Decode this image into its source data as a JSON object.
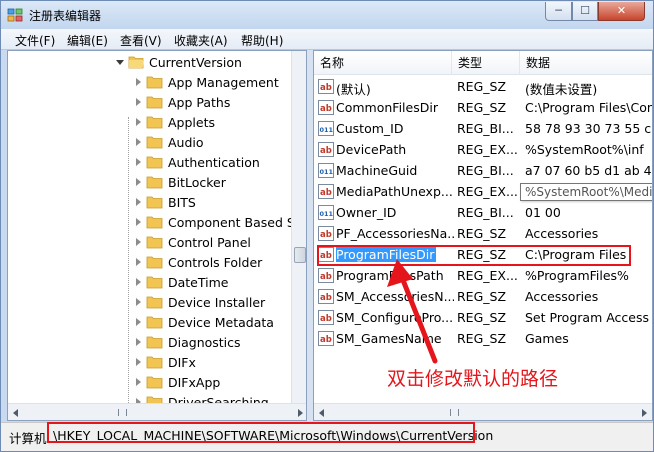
{
  "window": {
    "title": "注册表编辑器",
    "minimize": "─",
    "maximize": "☐",
    "close": "✕"
  },
  "menu": [
    "文件(F)",
    "编辑(E)",
    "查看(V)",
    "收藏夹(A)",
    "帮助(H)"
  ],
  "tree": {
    "parent": "CurrentVersion",
    "children": [
      "App Management",
      "App Paths",
      "Applets",
      "Audio",
      "Authentication",
      "BitLocker",
      "BITS",
      "Component Based Se",
      "Control Panel",
      "Controls Folder",
      "DateTime",
      "Device Installer",
      "Device Metadata",
      "Diagnostics",
      "DIFx",
      "DIFxApp",
      "DriverSearching"
    ]
  },
  "list": {
    "headers": [
      "名称",
      "类型",
      "数据"
    ],
    "rows": [
      {
        "icon": "string-value-icon",
        "name": "(默认)",
        "type": "REG_SZ",
        "data": "(数值未设置)"
      },
      {
        "icon": "string-value-icon",
        "name": "CommonFilesDir",
        "type": "REG_SZ",
        "data": "C:\\Program Files\\Con"
      },
      {
        "icon": "binary-value-icon",
        "name": "Custom_ID",
        "type": "REG_BI...",
        "data": "58 78 93 30 73 55 c8"
      },
      {
        "icon": "string-value-icon",
        "name": "DevicePath",
        "type": "REG_EX...",
        "data": "%SystemRoot%\\inf"
      },
      {
        "icon": "binary-value-icon",
        "name": "MachineGuid",
        "type": "REG_BI...",
        "data": "a7 07 60 b5 d1 ab 4a"
      },
      {
        "icon": "string-value-icon",
        "name": "MediaPathUnexp...",
        "type": "REG_EX...",
        "data": ""
      },
      {
        "icon": "binary-value-icon",
        "name": "Owner_ID",
        "type": "REG_BI...",
        "data": "01 00"
      },
      {
        "icon": "string-value-icon",
        "name": "PF_AccessoriesNa...",
        "type": "REG_SZ",
        "data": "Accessories"
      },
      {
        "icon": "string-value-icon",
        "name": "ProgramFilesDir",
        "type": "REG_SZ",
        "data": "C:\\Program Files"
      },
      {
        "icon": "string-value-icon",
        "name": "ProgramFilesPath",
        "type": "REG_EX...",
        "data": "%ProgramFiles%"
      },
      {
        "icon": "string-value-icon",
        "name": "SM_AccessoriesN...",
        "type": "REG_SZ",
        "data": "Accessories"
      },
      {
        "icon": "string-value-icon",
        "name": "SM_ConfigurePro...",
        "type": "REG_SZ",
        "data": "Set Program Access a"
      },
      {
        "icon": "string-value-icon",
        "name": "SM_GamesName",
        "type": "REG_SZ",
        "data": "Games"
      }
    ],
    "tooltip": "%SystemRoot%\\Media"
  },
  "annotation": {
    "text": "双击修改默认的路径",
    "color": "#e4161c"
  },
  "status": {
    "prefix": "计算机",
    "path": "\\HKEY_LOCAL_MACHINE\\SOFTWARE\\Microsoft\\Windows\\CurrentVersion"
  },
  "colors": {
    "selection": "#3399ff",
    "folder": "#f2c451",
    "frame": "#c9daf0"
  }
}
